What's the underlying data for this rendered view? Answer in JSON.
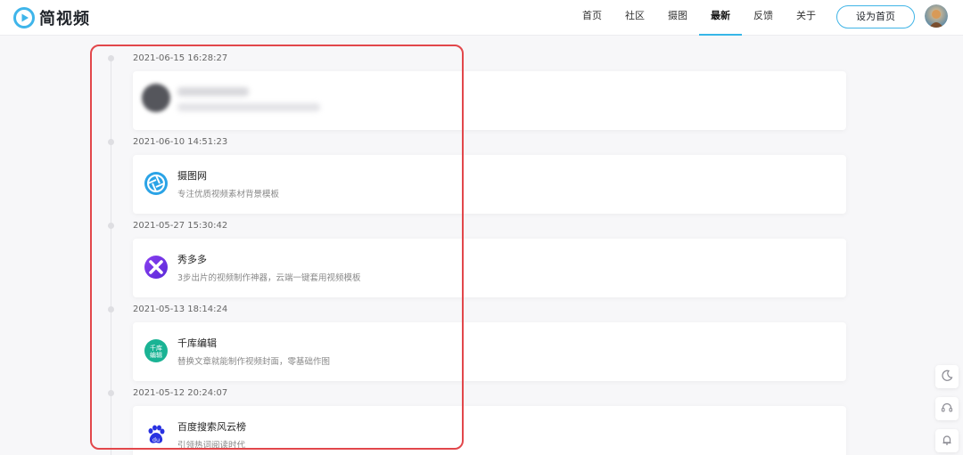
{
  "brand": {
    "name": "简视频",
    "accent": "#36b6e8"
  },
  "nav": {
    "items": [
      {
        "label": "首页",
        "active": false
      },
      {
        "label": "社区",
        "active": false
      },
      {
        "label": "摄图",
        "active": false
      },
      {
        "label": "最新",
        "active": true
      },
      {
        "label": "反馈",
        "active": false
      },
      {
        "label": "关于",
        "active": false
      }
    ],
    "set_home_label": "设为首页"
  },
  "timeline": [
    {
      "date": "2021-06-15 16:28:27",
      "title": "",
      "desc": "",
      "icon": "blurred-avatar",
      "blurred": true
    },
    {
      "date": "2021-06-10 14:51:23",
      "title": "摄图网",
      "desc": "专注优质视频素材背景模板",
      "icon": "shutter-icon"
    },
    {
      "date": "2021-05-27 15:30:42",
      "title": "秀多多",
      "desc": "3步出片的视频制作神器，云端一键套用视频模板",
      "icon": "x-logo-icon"
    },
    {
      "date": "2021-05-13 18:14:24",
      "title": "千库编辑",
      "desc": "替换文章就能制作视频封面，零基础作图",
      "icon": "qianku-icon",
      "icon_text": "千库编辑"
    },
    {
      "date": "2021-05-12 20:24:07",
      "title": "百度搜索风云榜",
      "desc": "引领热词阅读时代",
      "icon": "baidu-paw-icon",
      "icon_text": "du"
    }
  ],
  "float_buttons": [
    {
      "icon": "moon-icon"
    },
    {
      "icon": "headset-icon"
    },
    {
      "icon": "bell-icon"
    }
  ],
  "highlight_color": "#e2474b"
}
